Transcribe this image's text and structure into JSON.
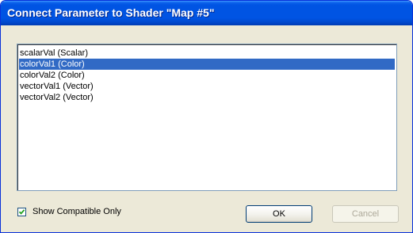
{
  "window": {
    "title": "Connect Parameter to Shader \"Map #5\""
  },
  "parameters": {
    "items": [
      {
        "label": "scalarVal (Scalar)",
        "selected": false
      },
      {
        "label": "colorVal1 (Color)",
        "selected": true
      },
      {
        "label": "colorVal2 (Color)",
        "selected": false
      },
      {
        "label": "vectorVal1 (Vector)",
        "selected": false
      },
      {
        "label": "vectorVal2 (Vector)",
        "selected": false
      }
    ]
  },
  "options": {
    "show_compatible_label": "Show Compatible Only",
    "show_compatible_checked": true
  },
  "buttons": {
    "ok_label": "OK",
    "cancel_label": "Cancel",
    "cancel_enabled": false
  },
  "colors": {
    "selection": "#316ac5",
    "titlebar": "#0054e3",
    "dialog_face": "#ece9d8"
  }
}
